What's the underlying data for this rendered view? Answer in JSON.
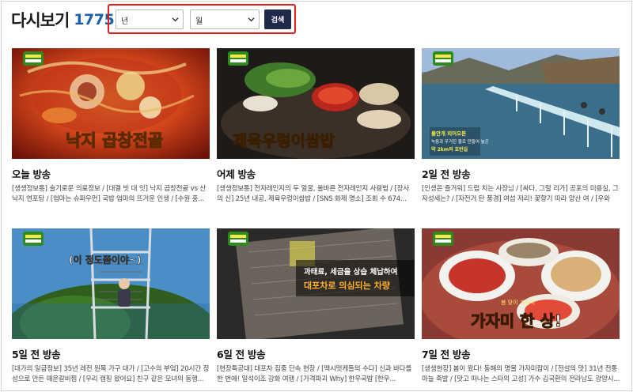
{
  "header": {
    "title": "다시보기",
    "count": "1775"
  },
  "filters": {
    "year_label": "년",
    "month_label": "월",
    "search_label": "검색"
  },
  "thumbnail_text": {
    "v1": "낙지 곱창전골",
    "v2": "제육우렁이쌈밥",
    "v3_caption1": "물안개 피어오른",
    "v3_caption2": "녹음과 우거진 물로 만들어 놓은",
    "v3_caption3": "약 2km의 호반길",
    "v4": "(이 정도쯤이야~)",
    "v5_line1": "과태료, 세금을 상습 체납하여",
    "v5_line2": "대포차로 의심되는 차량",
    "v6_small": "봄 맞이 가자미",
    "v6": "가자미 한 상!"
  },
  "videos": [
    {
      "title": "오늘 방송",
      "desc": "[생생정보통] 슬기로운 의료정보 / [대결 빗 대 잇] 낙지 곱창전골 vs 산낙지 연포탕 / [엄마는 슈퍼우먼] 국밥 엄마의 뜨거운 인생 / [수원 홍..."
    },
    {
      "title": "어제 방송",
      "desc": "[생생정보통] 전자레인지의 두 얼굴, 올바른 전자레인지 사용법 / [장사의 신] 25년 내공, 제육우렁이쌈밥 / [SNS 화제 명소] 조회 수 674..."
    },
    {
      "title": "2일 전 방송",
      "desc": "[인생은 즐거워] 드럼 치는 사장님 / [싸다, 그럴 리가] 공포의 미용실, 그 자성세는? / [자전거 탄 풍경] 여섬 저리! 꽃향기 따라 양산 여 / [우와한..."
    },
    {
      "title": "5일 전 방송",
      "desc": "[대가의 일급정보] 35년 레전 원목 가구 대가 / [고수의 부엌] 20시간 정성으로 만든 매운갈비찜 / [우리 캠핑 왔어요] 친구 같은 모녀의 동행..."
    },
    {
      "title": "6일 전 방송",
      "desc": "[현장특공대] 대포차 집중 단속 현장 / [맥시멋케들의 수다] 신과 바다를 한 번에! 일석이조 강화 여행 / [가격파괴 Why] 한우국밥 [한우..."
    },
    {
      "title": "7일 전 방송",
      "desc": "[생생현장] 봄이 왔다! 동해의 명물 가자미잡이 / [전설의 맛] 31년 전통 마늘 족발 / [맛고 떠나는 스타의 고성] 가수 김국환의 전라남도 광양시..."
    }
  ]
}
